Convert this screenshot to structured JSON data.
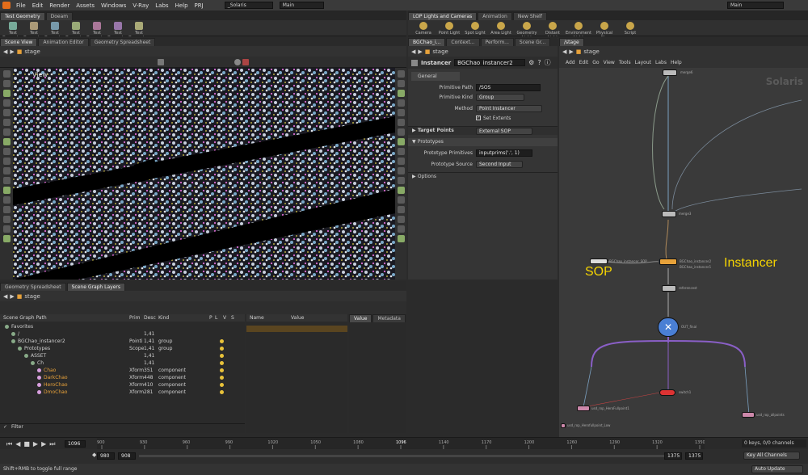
{
  "menu": [
    "File",
    "Edit",
    "Render",
    "Assets",
    "Windows",
    "V-Ray",
    "Labs",
    "Help",
    "PRJ"
  ],
  "desktop": "_Solaris",
  "main_label": "Main",
  "main_label_right": "Main",
  "shelf_left_tabs": [
    "Test Geometry",
    "Doeam"
  ],
  "shelf_left_tools": [
    "Test Geometry: C",
    "Test Geometry: P",
    "Test Geometry: R",
    "Test Geometry: S",
    "Test Geometry: T",
    "Test Geometry: T",
    "Test Geometry: T"
  ],
  "shelf_right_tabs": [
    "LOP Lights and Cameras",
    "Animation",
    "New Shelf"
  ],
  "shelf_right_tools": [
    "Camera",
    "Point Light",
    "Spot Light",
    "Area Light",
    "Geometry Light",
    "Distant Light",
    "Environment Light",
    "Physical Sky",
    "Script"
  ],
  "left_pane_tabs": [
    "Scene View",
    "Animation Editor",
    "Geometry Spreadsheet"
  ],
  "stage": "stage",
  "viewport_label": "View",
  "param_tabs": [
    "BGChao_i...",
    "Context...",
    "Perform...",
    "Scene Gr..."
  ],
  "node_type": "Instancer",
  "node_name": "BGChao_instancer2",
  "section_general": "General",
  "primitive_path_label": "Primitive Path",
  "primitive_path": "/SOS",
  "primitive_kind_label": "Primitive Kind",
  "primitive_kind": "Group",
  "method_label": "Method",
  "method": "Point Instancer",
  "set_extents": "Set Extents",
  "target_points_label": "Target Points",
  "target_points": "External SOP",
  "section_prototypes": "Prototypes",
  "proto_prims_label": "Prototype Primitives",
  "proto_prims": "inputprims('.', 1)",
  "proto_source_label": "Prototype Source",
  "proto_source": "Second Input",
  "section_options": "Options",
  "network_tab": "/stage",
  "network_menu": [
    "Add",
    "Edit",
    "Go",
    "View",
    "Tools",
    "Layout",
    "Labs",
    "Help"
  ],
  "network_watermark": "Solaris",
  "sop_label": "SOP",
  "instancer_label": "Instancer",
  "net_nodes": {
    "merge6": "merge6",
    "merge3": "merge3",
    "sop_name": "BGChao_instancer_SOP",
    "inst_name": "BGChao_instancer2",
    "inst_sub": "BGChao_instancer1",
    "reference": "referencest",
    "final": "OUT_final",
    "switch": "switch1",
    "rop1": "usd_rop_HeroFullpoint1",
    "rop2": "usd_rop_Herofullpoint_Low",
    "rop3": "usd_rop_allpoints"
  },
  "bottom_tabs": [
    "Geometry Spreadsheet",
    "Scene Graph Layers"
  ],
  "sg_columns": [
    "Scene Graph Path",
    "Prim",
    "Desc",
    "Kind",
    "P",
    "L",
    "V",
    "S"
  ],
  "sg_rows": [
    {
      "name": "Favorites",
      "prim": "",
      "desc": "",
      "kind": "",
      "gold": false,
      "indent": 0
    },
    {
      "name": "/",
      "prim": "",
      "desc": "1,41",
      "kind": "",
      "gold": false,
      "indent": 1
    },
    {
      "name": "BGChao_instancer2",
      "prim": "Pointi",
      "desc": "1,41",
      "kind": "group",
      "gold": false,
      "indent": 1
    },
    {
      "name": "Prototypes",
      "prim": "Scope",
      "desc": "1,41",
      "kind": "group",
      "gold": false,
      "indent": 2
    },
    {
      "name": "ASSET",
      "prim": "",
      "desc": "1,41",
      "kind": "",
      "gold": false,
      "indent": 3
    },
    {
      "name": "Ch",
      "prim": "",
      "desc": "1,41",
      "kind": "",
      "gold": false,
      "indent": 4
    },
    {
      "name": "Chao",
      "prim": "Xform",
      "desc": "351",
      "kind": "component",
      "gold": true,
      "indent": 5
    },
    {
      "name": "DarkChao",
      "prim": "Xform",
      "desc": "448",
      "kind": "component",
      "gold": true,
      "indent": 5
    },
    {
      "name": "HeroChao",
      "prim": "Xform",
      "desc": "410",
      "kind": "component",
      "gold": true,
      "indent": 5
    },
    {
      "name": "DmoChao",
      "prim": "Xform",
      "desc": "281",
      "kind": "component",
      "gold": true,
      "indent": 5
    }
  ],
  "attr_cols": [
    "Name",
    "Value"
  ],
  "value_tabs": [
    "Value",
    "Metadata"
  ],
  "filter": "Filter",
  "frame": "1096",
  "timeline_ticks": [
    "900",
    "930",
    "960",
    "990",
    "1020",
    "1050",
    "1080",
    "1096",
    "1140",
    "1170",
    "1200",
    "1260",
    "1290",
    "1320",
    "1350"
  ],
  "start_a": "980",
  "start_b": "908",
  "end_a": "1375",
  "end_b": "1375",
  "keys_info": "0 keys, 0/0 channels",
  "key_all": "Key All Channels",
  "status": "Shift+RMB to toggle full range",
  "auto_update": "Auto Update",
  "colors": {
    "accent": "#e8a23a",
    "sop_text": "#f5d400",
    "wire": "#8a5fc7",
    "final": "#4a7fd4"
  }
}
